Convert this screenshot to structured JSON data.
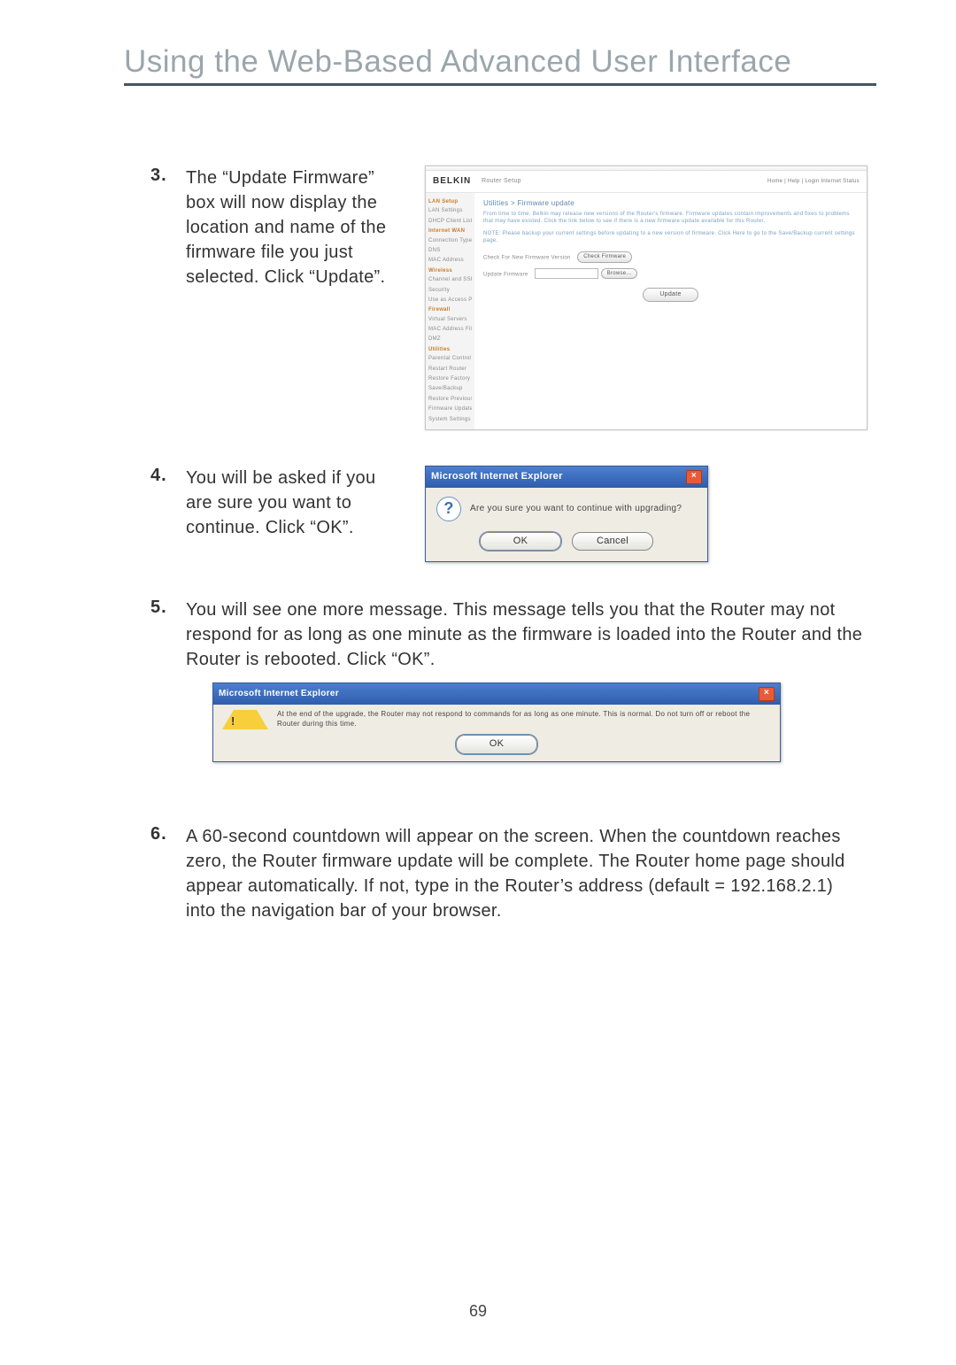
{
  "page": {
    "title": "Using the Web-Based Advanced User Interface",
    "number": "69"
  },
  "steps": {
    "s3": {
      "num": "3.",
      "text": "The “Update Firmware” box will now display the location and name of the firmware file you just selected. Click “Update”."
    },
    "s4": {
      "num": "4.",
      "text": "You will be asked if you are sure you want to continue. Click “OK”."
    },
    "s5": {
      "num": "5.",
      "text": "You will see one more message. This message tells you that the Router may not respond for as long as one minute as the firmware is loaded into the Router and the Router is rebooted. Click “OK”."
    },
    "s6": {
      "num": "6.",
      "text": "A 60-second countdown will appear on the screen. When the countdown reaches zero, the Router firmware update will be complete. The Router home page should appear automatically. If not, type in the Router’s address (default = 192.168.2.1) into the navigation bar of your browser."
    }
  },
  "belkin": {
    "logo": "BELKIN",
    "product": "Router Setup",
    "topright": "Home | Help | Login  Internet Status",
    "section_title": "Utilities > Firmware update",
    "para1": "From time to time, Belkin may release new versions of the Router's firmware. Firmware updates contain improvements and fixes to problems that may have existed. Click the link below to see if there is a new firmware update available for this Router.",
    "para2": "NOTE: Please backup your current settings before updating to a new version of firmware. Click Here to go to the Save/Backup current settings page.",
    "check_label": "Check For New Firmware Version",
    "check_btn": "Check Firmware",
    "update_label": "Update Firmware",
    "browse_btn": "Browse...",
    "update_btn": "Update",
    "sidebar": {
      "h1": "LAN Setup",
      "i1a": "LAN Settings",
      "i1b": "DHCP Client List",
      "h2": "Internet WAN",
      "i2a": "Connection Type",
      "i2b": "DNS",
      "i2c": "MAC Address",
      "h3": "Wireless",
      "i3a": "Channel and SSID",
      "i3b": "Security",
      "i3c": "Use as Access Pt",
      "h4": "Firewall",
      "i4a": "Virtual Servers",
      "i4b": "MAC Address Filter",
      "i4c": "DMZ",
      "h5": "Utilities",
      "i5a": "Parental Control",
      "i5b": "Restart Router",
      "i5c": "Restore Factory",
      "i5d": "Save/Backup",
      "i5e": "Restore Previous",
      "i5f": "Firmware Update",
      "i5g": "System Settings"
    }
  },
  "dialog1": {
    "title": "Microsoft Internet Explorer",
    "message": "Are you sure you want to continue with upgrading?",
    "ok": "OK",
    "cancel": "Cancel"
  },
  "dialog2": {
    "title": "Microsoft Internet Explorer",
    "message": "At the end of the upgrade, the Router may not respond to commands for as long as one minute. This is normal. Do not turn off or reboot the Router during this time.",
    "ok": "OK"
  }
}
